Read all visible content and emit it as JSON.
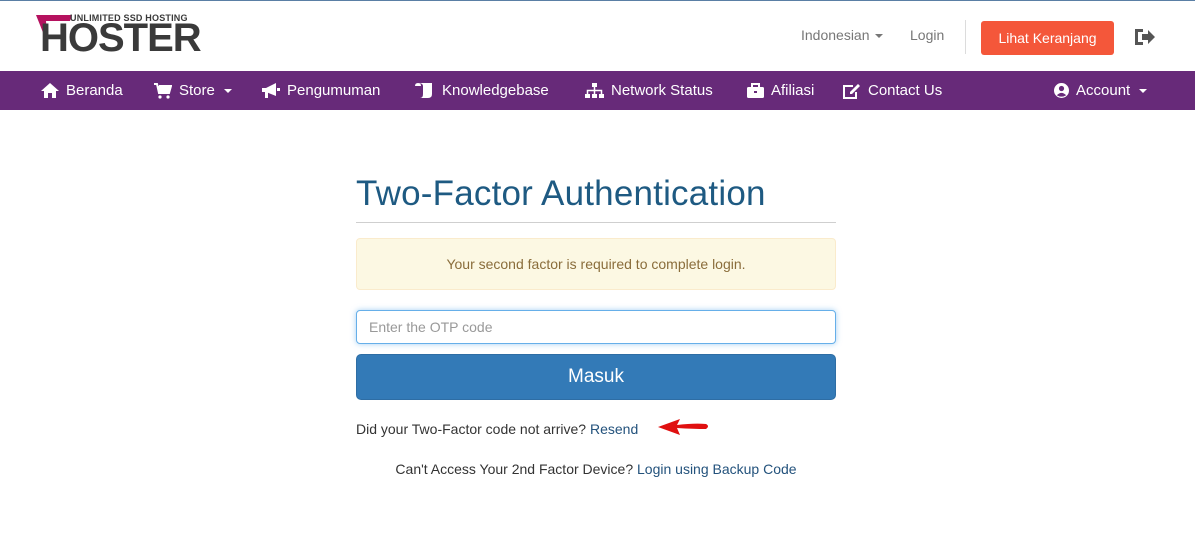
{
  "brand": {
    "tagline": "UNLIMITED SSD HOSTING",
    "name": "HOSTER",
    "accent_color": "#b5125f"
  },
  "top_bar": {
    "language_label": "Indonesian",
    "login_label": "Login",
    "cart_button_label": "Lihat Keranjang",
    "cart_button_color": "#f4573a",
    "logout_icon": "sign-out-icon"
  },
  "navbar": {
    "background_color": "#672a79",
    "items": [
      {
        "label": "Beranda",
        "icon": "home-icon"
      },
      {
        "label": "Store",
        "icon": "shopping-cart-icon",
        "dropdown": true
      },
      {
        "label": "Pengumuman",
        "icon": "bullhorn-icon"
      },
      {
        "label": "Knowledgebase",
        "icon": "scroll-icon"
      },
      {
        "label": "Network Status",
        "icon": "sitemap-icon"
      },
      {
        "label": "Afiliasi",
        "icon": "briefcase-icon"
      },
      {
        "label": "Contact Us",
        "icon": "edit-icon"
      }
    ],
    "account": {
      "label": "Account",
      "icon": "user-circle-icon",
      "dropdown": true
    }
  },
  "main": {
    "title": "Two-Factor Authentication",
    "alert_message": "Your second factor is required to complete login.",
    "otp_placeholder": "Enter the OTP code",
    "submit_label": "Masuk",
    "resend_prompt": "Did your Two-Factor code not arrive?",
    "resend_link": "Resend",
    "backup_prompt": "Can't Access Your 2nd Factor Device?",
    "backup_link": "Login using Backup Code"
  }
}
